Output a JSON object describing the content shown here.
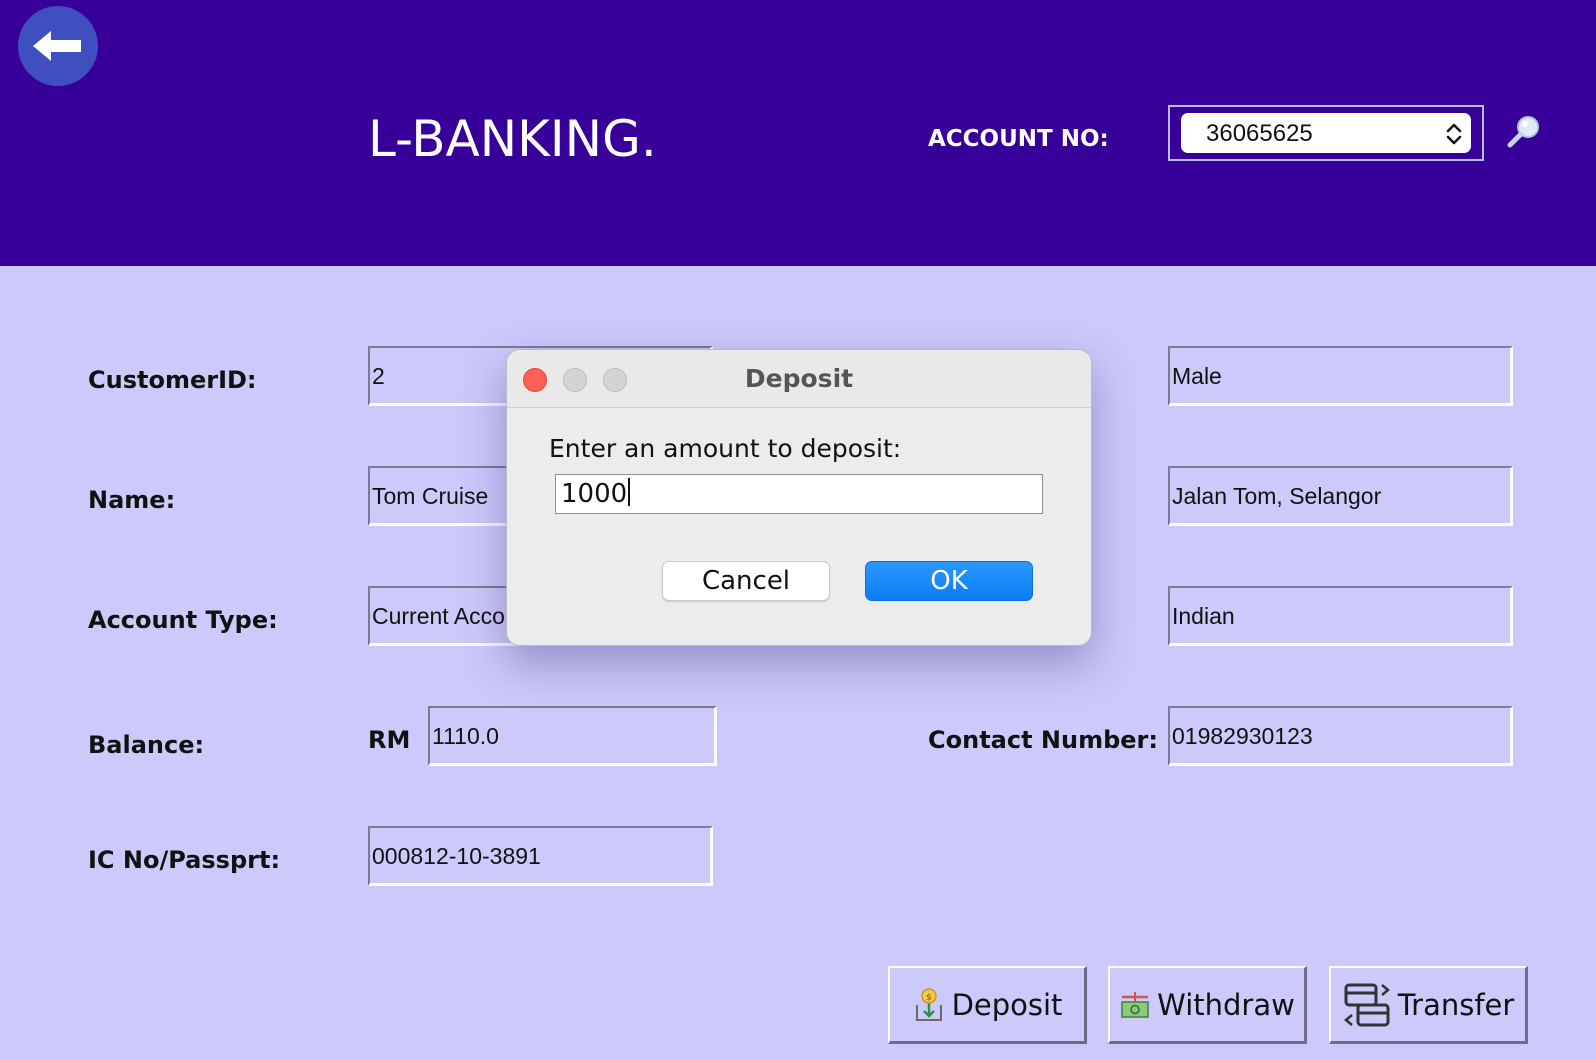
{
  "header": {
    "app_title": "L-BANKING.",
    "account_label": "ACCOUNT NO:",
    "account_selected": "36065625"
  },
  "form": {
    "customer_id": {
      "label": "CustomerID:",
      "value": "2"
    },
    "name": {
      "label": "Name:",
      "value": "Tom Cruise"
    },
    "account_type": {
      "label": "Account Type:",
      "value": "Current Account"
    },
    "balance": {
      "label": "Balance:",
      "currency": "RM",
      "value": "1110.0"
    },
    "ic_no": {
      "label": "IC No/Passprt:",
      "value": "000812-10-3891"
    },
    "gender": {
      "value": "Male"
    },
    "address": {
      "value": "Jalan Tom, Selangor"
    },
    "nationality": {
      "value": "Indian"
    },
    "contact": {
      "label": "Contact Number:",
      "value": "01982930123"
    }
  },
  "actions": {
    "deposit": "Deposit",
    "withdraw": "Withdraw",
    "transfer": "Transfer"
  },
  "dialog": {
    "title": "Deposit",
    "prompt": "Enter an amount to deposit:",
    "input_value": "1000",
    "cancel": "Cancel",
    "ok": "OK"
  },
  "icons": {
    "back": "arrow-left-icon",
    "search": "magnifier-icon",
    "deposit": "deposit-coin-icon",
    "withdraw": "withdraw-cash-icon",
    "transfer": "transfer-icon"
  },
  "colors": {
    "header_bg": "#360099",
    "body_bg": "#cccafb",
    "ok_button": "#0a7df6",
    "back_button": "#3f4fc0"
  }
}
